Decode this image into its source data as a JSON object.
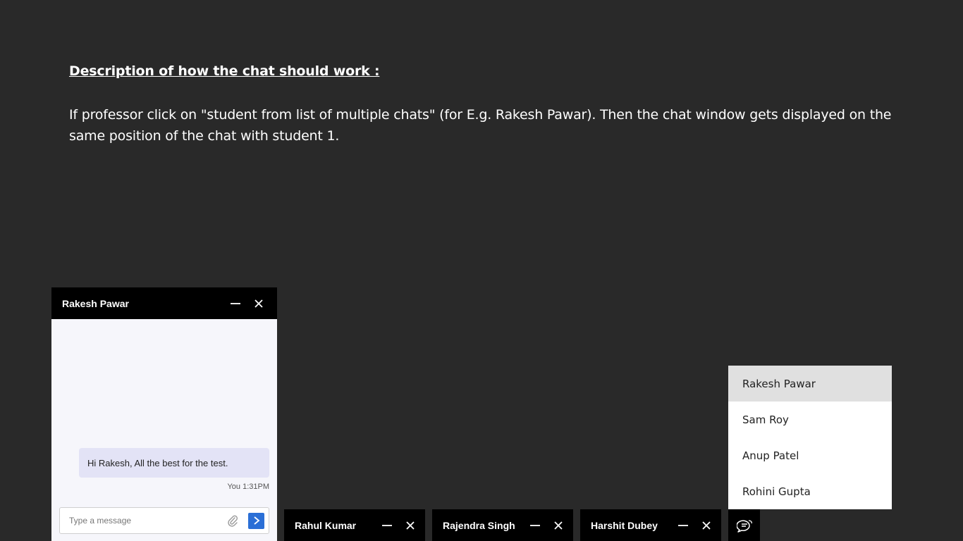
{
  "description": {
    "title": "Description of how the chat should work :",
    "body": "If professor click on \"student from list of multiple chats\" (for E.g. Rakesh Pawar). Then the chat window gets displayed on the same position of the chat with student 1."
  },
  "active_chat": {
    "name": "Rakesh Pawar",
    "messages": [
      {
        "text": "Hi Rakesh, All the best for the test.",
        "meta": "You 1:31PM"
      }
    ],
    "composer": {
      "placeholder": "Type a message"
    }
  },
  "minimized_chats": [
    {
      "name": "Rahul Kumar"
    },
    {
      "name": "Rajendra Singh"
    },
    {
      "name": "Harshit Dubey"
    }
  ],
  "chat_list": {
    "items": [
      {
        "name": "Rakesh Pawar",
        "selected": true
      },
      {
        "name": "Sam Roy",
        "selected": false
      },
      {
        "name": "Anup Patel",
        "selected": false
      },
      {
        "name": "Rohini Gupta",
        "selected": false
      }
    ]
  },
  "icons": {
    "minimize": "minimize-icon",
    "close": "close-icon",
    "attach": "paperclip-icon",
    "send": "send-arrow-icon",
    "chats": "chat-bubbles-icon"
  },
  "colors": {
    "background": "#292929",
    "header": "#000000",
    "send_button": "#2b6fd6",
    "bubble": "#e3e3f6",
    "selected_item": "#e0e0e0"
  }
}
